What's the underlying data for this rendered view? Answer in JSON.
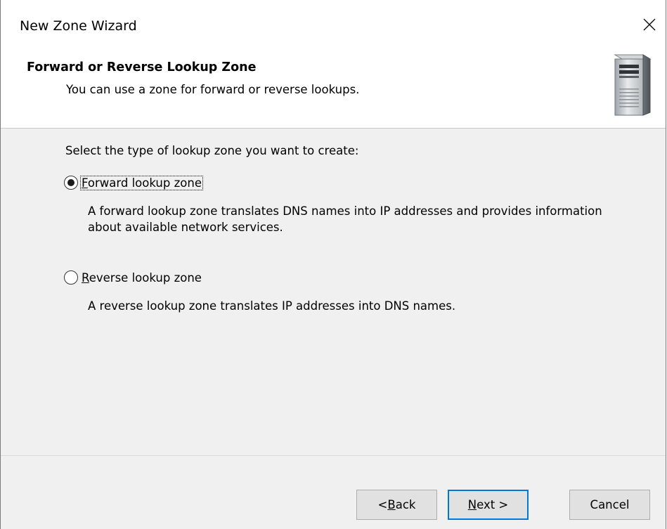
{
  "window": {
    "title": "New Zone Wizard"
  },
  "header": {
    "title": "Forward or Reverse Lookup Zone",
    "subtitle": "You can use a zone for forward or reverse lookups.",
    "icon": "server-icon"
  },
  "content": {
    "prompt": "Select the type of lookup zone you want to create:",
    "options": [
      {
        "mnemonic": "F",
        "label_rest": "orward lookup zone",
        "selected": true,
        "description": "A forward lookup zone translates DNS names into IP addresses and provides information about available network services."
      },
      {
        "mnemonic": "R",
        "label_rest": "everse lookup zone",
        "selected": false,
        "description": "A reverse lookup zone translates IP addresses into DNS names."
      }
    ]
  },
  "footer": {
    "back": {
      "prefix": "< ",
      "mnemonic": "B",
      "rest": "ack"
    },
    "next": {
      "mnemonic": "N",
      "rest": "ext >"
    },
    "cancel_label": "Cancel"
  },
  "colors": {
    "accent": "#0078d7",
    "dialog_bg": "#f0f0f0",
    "header_bg": "#ffffff"
  }
}
